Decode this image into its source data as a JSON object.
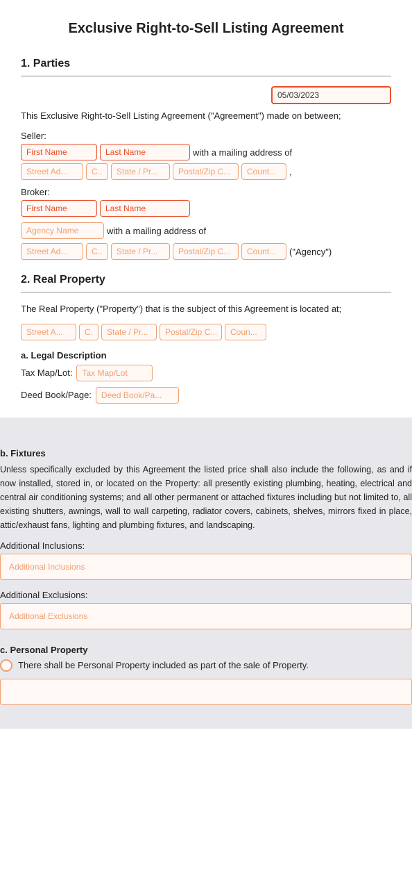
{
  "title": "Exclusive Right-to-Sell Listing Agreement",
  "sections": {
    "parties": {
      "label": "1. Parties",
      "intro": "This Exclusive Right-to-Sell Listing Agreement (\"Agreement\") made on between;",
      "date_value": "05/03/2023",
      "seller_label": "Seller:",
      "seller_first_placeholder": "First Name",
      "seller_last_placeholder": "Last Name",
      "seller_address_text": "with a mailing address of",
      "broker_label": "Broker:",
      "broker_first_placeholder": "First Name",
      "broker_last_placeholder": "Last Name",
      "agency_name_placeholder": "Agency Name",
      "agency_address_text": "with a mailing address of",
      "agency_suffix": "(\"Agency\")"
    },
    "real_property": {
      "label": "2. Real Property",
      "intro": "The Real Property (\"Property\") that is the subject of this Agreement is located at;",
      "legal_description": {
        "label": "a. Legal Description",
        "tax_map_lot_label": "Tax Map/Lot:",
        "tax_map_lot_placeholder": "Tax Map/Lot",
        "deed_book_label": "Deed Book/Page:",
        "deed_book_placeholder": "Deed Book/Pa..."
      }
    },
    "fixtures": {
      "label": "b. Fixtures",
      "body": "Unless specifically excluded by this Agreement the listed price shall also include the following, as and if now installed, stored in, or located on the Property: all presently existing plumbing, heating, electrical and central air conditioning systems; and all other permanent or attached fixtures including but not limited to, all existing shutters, awnings, wall to wall carpeting, radiator covers, cabinets, shelves, mirrors fixed in place, attic/exhaust fans, lighting and plumbing fixtures, and landscaping.",
      "additional_inclusions_label": "Additional Inclusions:",
      "additional_inclusions_placeholder": "Additional Inclusions",
      "additional_exclusions_label": "Additional Exclusions:",
      "additional_exclusions_placeholder": "Additional Exclusions"
    },
    "personal_property": {
      "label": "c. Personal Property",
      "text": "There shall be Personal Property included as part of the sale of Property."
    }
  },
  "address_fields": {
    "street": "Street Ad...",
    "city": "C...",
    "state": "State / Pr...",
    "postal": "Postal/Zip C...",
    "country": "Count..."
  },
  "address_fields2": {
    "street": "Street A...",
    "city": "C...",
    "state": "State / Pr...",
    "postal": "Postal/Zip C...",
    "country": "Coun..."
  }
}
